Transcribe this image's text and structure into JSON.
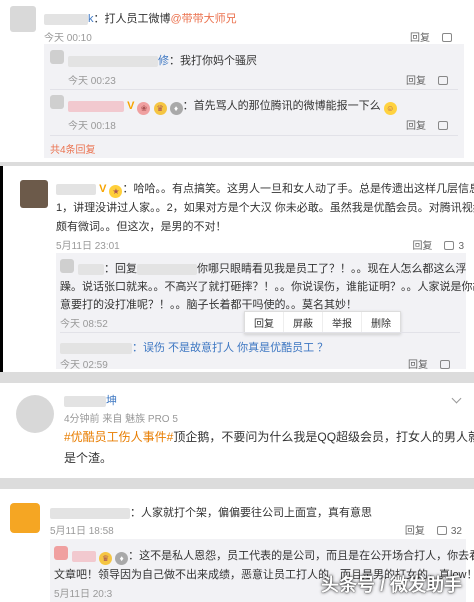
{
  "block1": {
    "comment1": {
      "user_suffix": "k",
      "text": "：打人员工微博",
      "mention": "@带带大师兄",
      "time": "今天 00:10",
      "reply": "回复"
    },
    "reply1": {
      "user_suffix": "修",
      "text": "：我打你妈个骚屄",
      "time": "今天 00:23",
      "reply": "回复"
    },
    "reply2": {
      "text": "：首先骂人的那位腾讯的微博能报一下么",
      "time": "今天 00:18",
      "reply": "回复"
    },
    "more_replies": "共4条回复"
  },
  "block2": {
    "comment": {
      "line1": "：哈哈。。有点搞笑。这男人一旦和女人动了手。总是传遗出这样几层信息。",
      "line2": "1，讲理没讲过人家。。2，如果对方是个大汉 你未必敢。虽然我是优酷会员。对腾讯视频也",
      "line3": "颇有微词。。但这次，是男的不对！",
      "time": "5月11日 23:01",
      "reply": "回复",
      "likes": "3"
    },
    "reply1": {
      "prefix": "：回复",
      "line1": "你哪只眼睛看见我是员工了？！。。现在人怎么都这么浮",
      "line2": "躁。说话张口就来。。不高兴了就打砸摔？！。。你说误伤，谁能证明？。。人家说是你故",
      "line3": "意要打的没打准呢？！。。脑子长着都干吗使的。。莫名其妙！",
      "time": "今天 08:52"
    },
    "popup": [
      "回复",
      "屏蔽",
      "举报",
      "删除"
    ],
    "reply2": {
      "text": "：误伤  不是故意打人  你真是优酷员工  ？",
      "time": "今天 02:59",
      "reply": "回复"
    }
  },
  "block3": {
    "user_suffix": "坤",
    "meta": "4分钟前 来自 魅族 PRO 5",
    "topic": "#优酷员工伤人事件#",
    "text1": "顶企鹅，不要问为什么我是QQ超级会员，打女人的男人就",
    "text2": "是个渣。"
  },
  "block4": {
    "comment": {
      "text": "：人家就打个架，偏偏要往公司上面宣，真有意思",
      "time": "5月11日 18:58",
      "reply": "回复",
      "likes": "32"
    },
    "reply": {
      "line1": "：这不是私人恩怨，员工代表的是公司，而且是在公开场合打人，你去看看整个",
      "line2": "文章吧！领导因为自己做不出来成绩，恶意让员工打人的，而且是男的打女的，真low！",
      "time": "5月11日 20:3"
    }
  },
  "watermark": "头条号 / 微发助手",
  "colors": {
    "link": "#eb7350",
    "blue": "#3d77c2",
    "vip": "#f7a400",
    "topic": "#e87d00"
  }
}
